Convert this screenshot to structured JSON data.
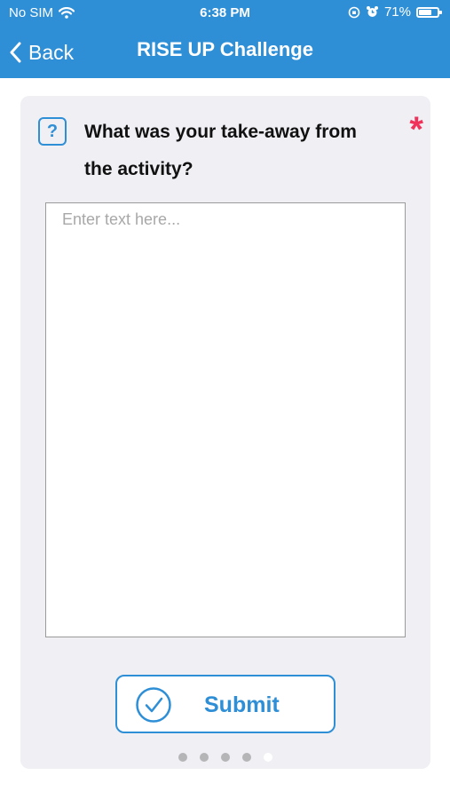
{
  "status_bar": {
    "carrier": "No SIM",
    "time": "6:38 PM",
    "battery": "71%",
    "battery_level": 0.71
  },
  "navbar": {
    "back_label": "Back",
    "title": "RISE UP Challenge"
  },
  "question": {
    "help_icon_glyph": "?",
    "text": "What was your take-away from the activity?",
    "required_mark": "*"
  },
  "answer": {
    "value": "",
    "placeholder": "Enter text here..."
  },
  "submit": {
    "label": "Submit"
  },
  "pagination": {
    "total": 5,
    "current": 5
  },
  "colors": {
    "accent": "#2f8fd6",
    "required": "#f0325a",
    "card_bg": "#efeff4"
  }
}
